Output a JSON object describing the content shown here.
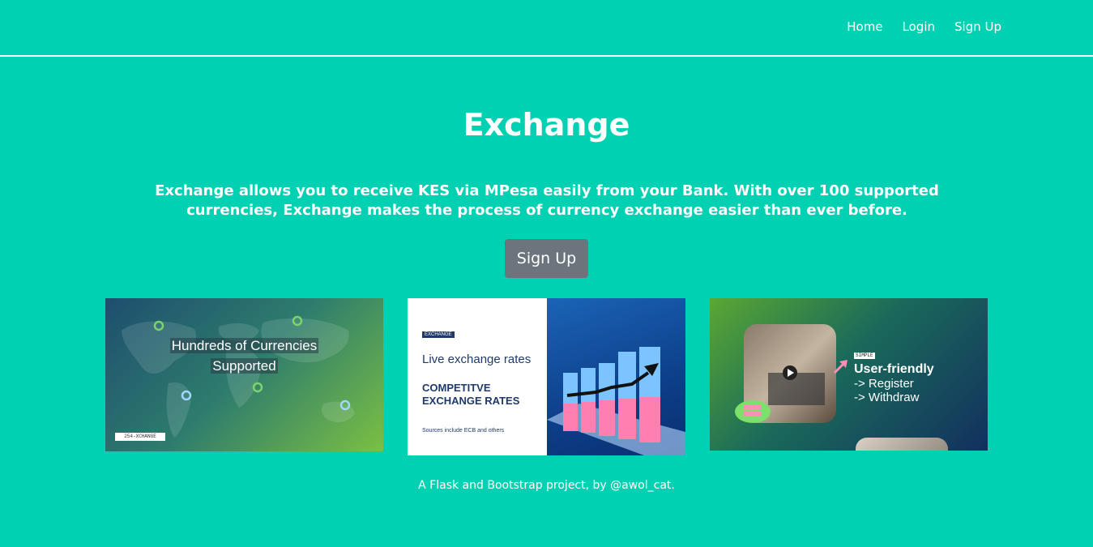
{
  "nav": {
    "links": [
      {
        "label": "Home"
      },
      {
        "label": "Login"
      },
      {
        "label": "Sign Up"
      }
    ]
  },
  "hero": {
    "title": "Exchange",
    "lead": "Exchange allows you to receive KES via MPesa easily from your Bank. With over 100 supported currencies, Exchange makes the process of currency exchange easier than ever before.",
    "cta_label": "Sign Up"
  },
  "cards": {
    "card1": {
      "line1": "Hundreds of Currencies",
      "line2": "Supported",
      "tag": "254-XCHANGE"
    },
    "card2": {
      "logo": "EXCHANGE",
      "live": "Live exchange rates",
      "competitive": "COMPETITVE EXCHANGE RATES",
      "sources": "Sources include ECB and others"
    },
    "card3": {
      "badge": "SIMPLE",
      "heading": "User-friendly",
      "step1": "-> Register",
      "step2": "-> Withdraw"
    }
  },
  "footer": {
    "text": "A Flask and Bootstrap project, by @awol_cat."
  },
  "colors": {
    "background": "#00d1b2",
    "button": "#6c757d",
    "text": "#ffffff",
    "navy": "#1f3a68"
  }
}
